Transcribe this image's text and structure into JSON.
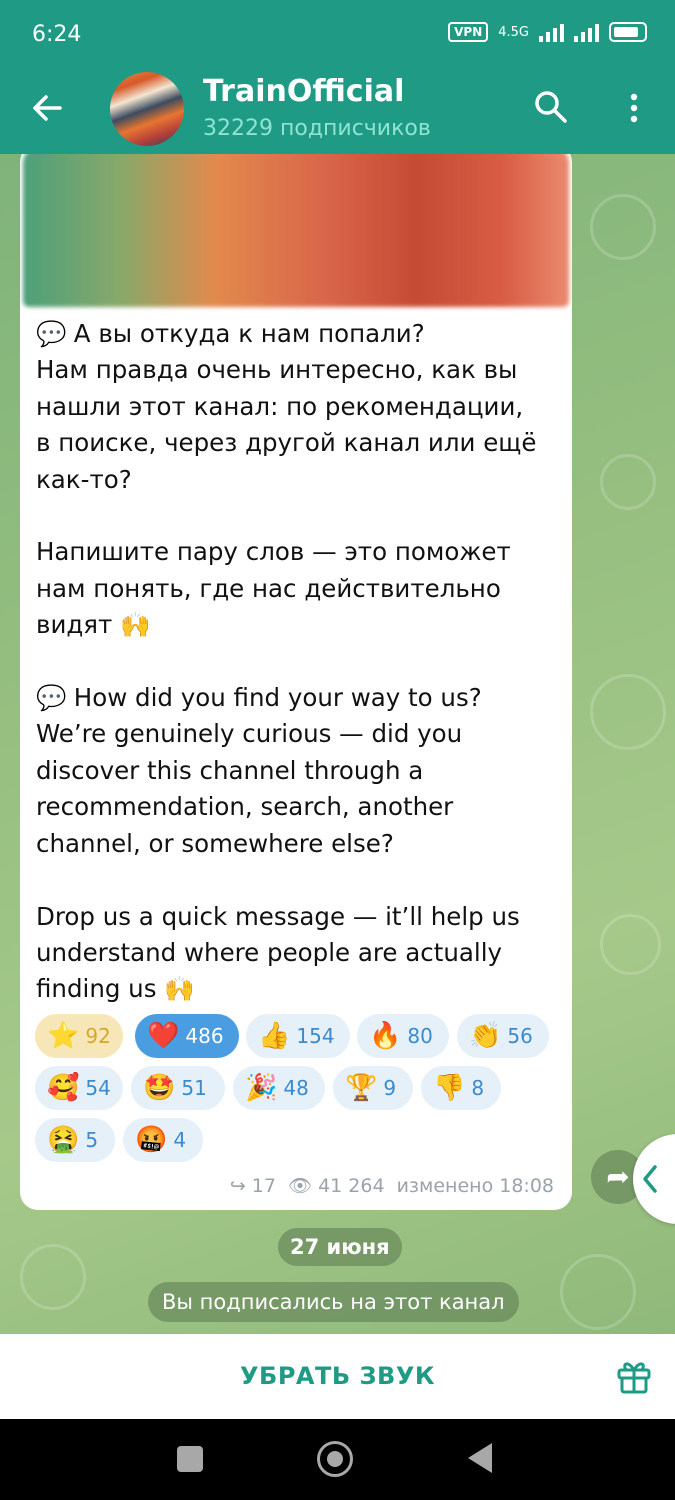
{
  "status_bar": {
    "time": "6:24",
    "vpn": "VPN",
    "network": "4.5G"
  },
  "header": {
    "title": "TrainOfficial",
    "subtitle": "32229 подписчиков"
  },
  "message": {
    "lines": [
      "А вы откуда к нам попали?",
      "Нам правда очень интересно, как вы",
      "нашли этот канал: по рекомендации,",
      "в поиске, через другой канал или ещё",
      "как-то?",
      "",
      "Напишите пару слов — это поможет",
      "нам понять, где нас действительно",
      "видят",
      "",
      "How did you find your way to us?",
      "We’re genuinely curious — did you",
      "discover this channel through a",
      "recommendation, search, another",
      "channel, or somewhere else?",
      "",
      "Drop us a quick message — it’ll help us",
      "understand where people are actually",
      "finding us"
    ],
    "reactions": [
      {
        "icon": "⭐",
        "count": "92"
      },
      {
        "icon": "❤️",
        "count": "486"
      },
      {
        "icon": "👍",
        "count": "154"
      },
      {
        "icon": "🔥",
        "count": "80"
      },
      {
        "icon": "👏",
        "count": "56"
      },
      {
        "icon": "🥰",
        "count": "54"
      },
      {
        "icon": "🤩",
        "count": "51"
      },
      {
        "icon": "🎉",
        "count": "48"
      },
      {
        "icon": "🏆",
        "count": "9"
      },
      {
        "icon": "👎",
        "count": "8"
      },
      {
        "icon": "🤮",
        "count": "5"
      },
      {
        "icon": "🤬",
        "count": "4"
      }
    ],
    "forwards": "17",
    "views": "41 264",
    "edited": "изменено 18:08"
  },
  "date_separator": "27 июня",
  "service_message": "Вы подписались на этот канал",
  "bottom": {
    "mute_label": "УБРАТЬ ЗВУК"
  },
  "colors": {
    "header": "#1f9b85",
    "accent": "#3a8ad0"
  }
}
